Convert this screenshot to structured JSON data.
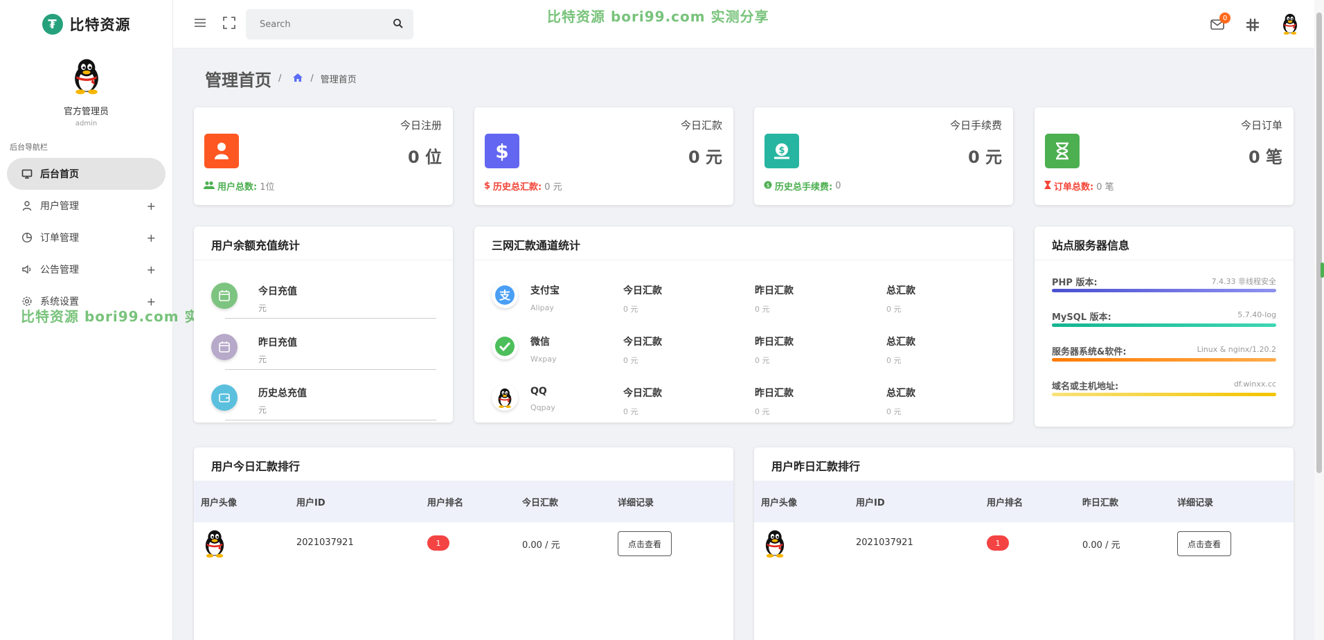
{
  "brand": {
    "name": "比特资源"
  },
  "profile": {
    "name": "官方管理员",
    "role": "admin"
  },
  "nav": {
    "caption": "后台导航栏",
    "items": [
      {
        "label": "后台首页",
        "icon": "monitor-icon",
        "active": true
      },
      {
        "label": "用户管理",
        "icon": "user-icon",
        "plus": "+"
      },
      {
        "label": "订单管理",
        "icon": "pie-chart-icon",
        "plus": "+"
      },
      {
        "label": "公告管理",
        "icon": "speaker-icon",
        "plus": "+"
      },
      {
        "label": "系统设置",
        "icon": "gear-icon",
        "plus": "+"
      }
    ]
  },
  "watermark": "比特资源 bori99.com 实测分享",
  "header": {
    "search_placeholder": "Search",
    "mail_badge": "0"
  },
  "page": {
    "title": "管理首页",
    "breadcrumb_sep": "/",
    "breadcrumb_current": "管理首页"
  },
  "stats": [
    {
      "title": "今日注册",
      "value": "0 位",
      "foot_key": "用户总数:",
      "foot_val": "1位",
      "color": "#ff5722",
      "key_color": "#4caf50"
    },
    {
      "title": "今日汇款",
      "value": "0 元",
      "foot_key": "历史总汇款:",
      "foot_val": "0 元",
      "color": "#6366f1",
      "key_color": "#f44336"
    },
    {
      "title": "今日手续费",
      "value": "0 元",
      "foot_key": "历史总手续费:",
      "foot_val": "0",
      "color": "#26b5a0",
      "key_color": "#4caf50"
    },
    {
      "title": "今日订单",
      "value": "0 笔",
      "foot_key": "订单总数:",
      "foot_val": "0 笔",
      "color": "#4caf50",
      "key_color": "#f44336"
    }
  ],
  "recharge": {
    "title": "用户余额充值统计",
    "rows": [
      {
        "label": "今日充值",
        "value": "元",
        "color": "#7cc47f"
      },
      {
        "label": "昨日充值",
        "value": "元",
        "color": "#b7a9c9"
      },
      {
        "label": "历史总充值",
        "value": "元",
        "color": "#5bc0de"
      }
    ]
  },
  "channels": {
    "title": "三网汇款通道统计",
    "rows": [
      {
        "name": "支付宝",
        "sub": "Alipay",
        "today": "今日汇款",
        "yesterday": "昨日汇款",
        "total": "总汇款",
        "v1": "0 元",
        "v2": "0 元",
        "v3": "0 元",
        "color": "#4a9ff5"
      },
      {
        "name": "微信",
        "sub": "Wxpay",
        "today": "今日汇款",
        "yesterday": "昨日汇款",
        "total": "总汇款",
        "v1": "0 元",
        "v2": "0 元",
        "v3": "0 元",
        "color": "#4cbf5a"
      },
      {
        "name": "QQ",
        "sub": "Qqpay",
        "today": "今日汇款",
        "yesterday": "昨日汇款",
        "total": "总汇款",
        "v1": "0 元",
        "v2": "0 元",
        "v3": "0 元",
        "color": "#222"
      }
    ]
  },
  "server": {
    "title": "站点服务器信息",
    "items": [
      {
        "key": "PHP 版本:",
        "val": "7.4.33 非线程安全",
        "color": "#6c6fe0"
      },
      {
        "key": "MySQL 版本:",
        "val": "5.7.40-log",
        "color": "#26c0a0"
      },
      {
        "key": "服务器系统&软件:",
        "val": "Linux & nginx/1.20.2",
        "color": "#ff8a1f"
      },
      {
        "key": "域名或主机地址:",
        "val": "df.winxx.cc",
        "color": "#f5d31c"
      }
    ]
  },
  "rank_today": {
    "title": "用户今日汇款排行",
    "headers": [
      "用户头像",
      "用户ID",
      "用户排名",
      "今日汇款",
      "详细记录"
    ],
    "row": {
      "id": "2021037921",
      "rank": "1",
      "amount": "0.00 / 元",
      "action": "点击查看"
    }
  },
  "rank_yesterday": {
    "title": "用户昨日汇款排行",
    "headers": [
      "用户头像",
      "用户ID",
      "用户排名",
      "昨日汇款",
      "详细记录"
    ],
    "row": {
      "id": "2021037921",
      "rank": "1",
      "amount": "0.00 / 元",
      "action": "点击查看"
    }
  }
}
